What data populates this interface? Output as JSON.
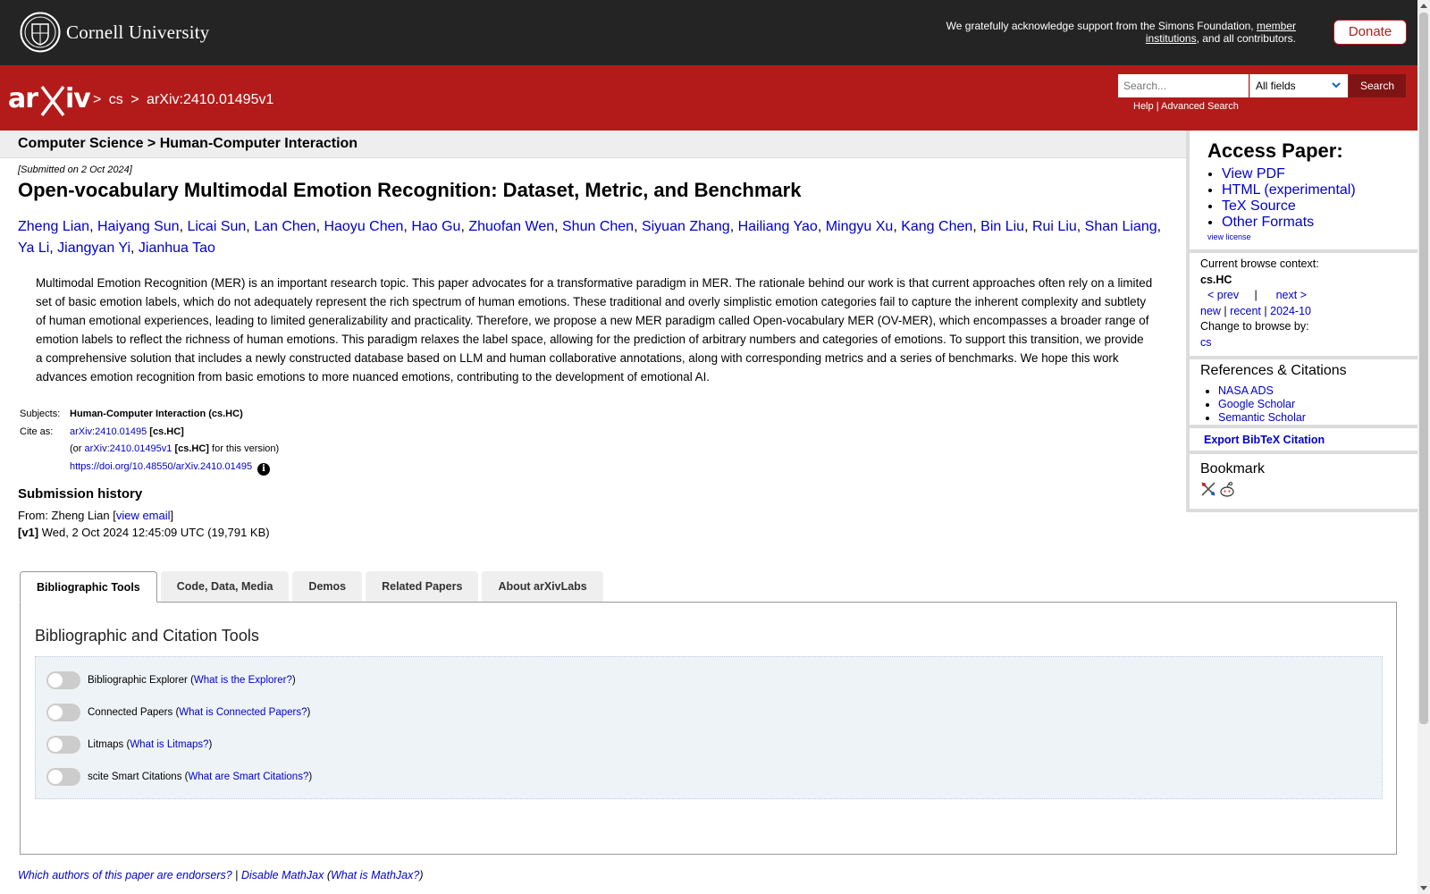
{
  "top": {
    "cornell_name": "Cornell University",
    "support_text_1": "We gratefully acknowledge support from the Simons Foundation,",
    "member_link": "member institutions",
    "support_text_2": ", and all contributors.",
    "donate_label": "Donate"
  },
  "header": {
    "logo_alt": "arXiv",
    "crumb_sep": ">",
    "crumb_cs": "cs",
    "crumb_id": "arXiv:2410.01495v1",
    "search_placeholder": "Search...",
    "field_selected": "All fields",
    "search_button": "Search",
    "help": "Help",
    "link_sep": "|",
    "advanced_search": "Advanced Search"
  },
  "paper": {
    "subject_heading": "Computer Science > Human-Computer Interaction",
    "submitted": "[Submitted on 2 Oct 2024]",
    "title": "Open-vocabulary Multimodal Emotion Recognition: Dataset, Metric, and Benchmark",
    "authors": [
      "Zheng Lian",
      "Haiyang Sun",
      "Licai Sun",
      "Lan Chen",
      "Haoyu Chen",
      "Hao Gu",
      "Zhuofan Wen",
      "Shun Chen",
      "Siyuan Zhang",
      "Hailiang Yao",
      "Mingyu Xu",
      "Kang Chen",
      "Bin Liu",
      "Rui Liu",
      "Shan Liang",
      "Ya Li",
      "Jiangyan Yi",
      "Jianhua Tao"
    ],
    "abstract": "Multimodal Emotion Recognition (MER) is an important research topic. This paper advocates for a transformative paradigm in MER. The rationale behind our work is that current approaches often rely on a limited set of basic emotion labels, which do not adequately represent the rich spectrum of human emotions. These traditional and overly simplistic emotion categories fail to capture the inherent complexity and subtlety of human emotional experiences, leading to limited generalizability and practicality. Therefore, we propose a new MER paradigm called Open-vocabulary MER (OV-MER), which encompasses a broader range of emotion labels to reflect the richness of human emotions. This paradigm relaxes the label space, allowing for the prediction of arbitrary numbers and categories of emotions. To support this transition, we provide a comprehensive solution that includes a newly constructed database based on LLM and human collaborative annotations, along with corresponding metrics and a series of benchmarks. We hope this work advances emotion recognition from basic emotions to more nuanced emotions, contributing to the development of emotional AI.",
    "subjects_label": "Subjects:",
    "subjects_value": "Human-Computer Interaction (cs.HC)",
    "cite_label": "Cite as:",
    "cite_link": "arXiv:2410.01495",
    "cite_tag": "[cs.HC]",
    "cite_or": "(or",
    "cite_v1_link": "arXiv:2410.01495v1",
    "cite_v1_tag": "[cs.HC]",
    "cite_v1_suffix": "for this version)",
    "doi_link": "https://doi.org/10.48550/arXiv.2410.01495",
    "doi_info_icon": "i",
    "history_heading": "Submission history",
    "from_prefix": "From: Zheng Lian [",
    "view_email": "view email",
    "from_suffix": "]",
    "v1_label": "[v1]",
    "v1_text": "Wed, 2 Oct 2024 12:45:09 UTC (19,791 KB)"
  },
  "sidebar": {
    "access_heading": "Access Paper:",
    "access_links": [
      "View PDF",
      "HTML (experimental)",
      "TeX Source",
      "Other Formats"
    ],
    "view_license": "view license",
    "browse_context_label": "Current browse context:",
    "browse_context_value": "cs.HC",
    "prev": "< prev",
    "sep": "|",
    "next": "next >",
    "new": "new",
    "recent": "recent",
    "month": "2024-10",
    "change_browse_label": "Change to browse by:",
    "browse_cs": "cs",
    "refs_heading": "References & Citations",
    "refs_links": [
      "NASA ADS",
      "Google Scholar",
      "Semantic Scholar"
    ],
    "export_bibtex": "Export BibTeX Citation",
    "bookmark_heading": "Bookmark"
  },
  "tabs": {
    "items": [
      "Bibliographic Tools",
      "Code, Data, Media",
      "Demos",
      "Related Papers",
      "About arXivLabs"
    ],
    "active_index": 0,
    "panel_heading": "Bibliographic and Citation Tools",
    "tools": [
      {
        "name": "Bibliographic Explorer",
        "link": "What is the Explorer?",
        "enabled": false
      },
      {
        "name": "Connected Papers",
        "link": "What is Connected Papers?",
        "enabled": false
      },
      {
        "name": "Litmaps",
        "link": "What is Litmaps?",
        "enabled": false
      },
      {
        "name": "scite Smart Citations",
        "link": "What are Smart Citations?",
        "enabled": false
      }
    ]
  },
  "footer": {
    "endorsers": "Which authors of this paper are endorsers?",
    "sep": "|",
    "disable_mathjax": "Disable MathJax",
    "what_mathjax": "What is MathJax?"
  },
  "colors": {
    "arxiv_red": "#b31b1b",
    "cornell_bar": "#242424",
    "link_blue": "#0000cc"
  }
}
